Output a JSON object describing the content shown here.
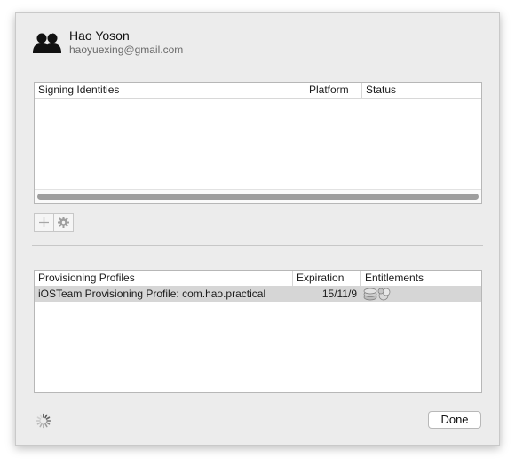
{
  "account": {
    "name": "Hao Yoson",
    "email": "haoyuexing@gmail.com",
    "icon": "users-icon"
  },
  "signing_identities": {
    "columns": [
      "Signing Identities",
      "Platform",
      "Status"
    ],
    "rows": []
  },
  "identity_actions": {
    "add_icon": "plus-icon",
    "settings_icon": "gear-icon"
  },
  "provisioning_profiles": {
    "columns": [
      "Provisioning Profiles",
      "Expiration",
      "Entitlements"
    ],
    "rows": [
      {
        "name": "iOSTeam Provisioning Profile: com.hao.practical",
        "expiration": "15/11/9",
        "entitlements": [
          "entitlement-stack-icon",
          "entitlement-game-icon"
        ],
        "selected": true
      }
    ]
  },
  "footer": {
    "activity_icon": "spinner-icon",
    "done_label": "Done"
  },
  "colors": {
    "selected_row": "#d6d6d6",
    "sheet_bg": "#ececec"
  }
}
